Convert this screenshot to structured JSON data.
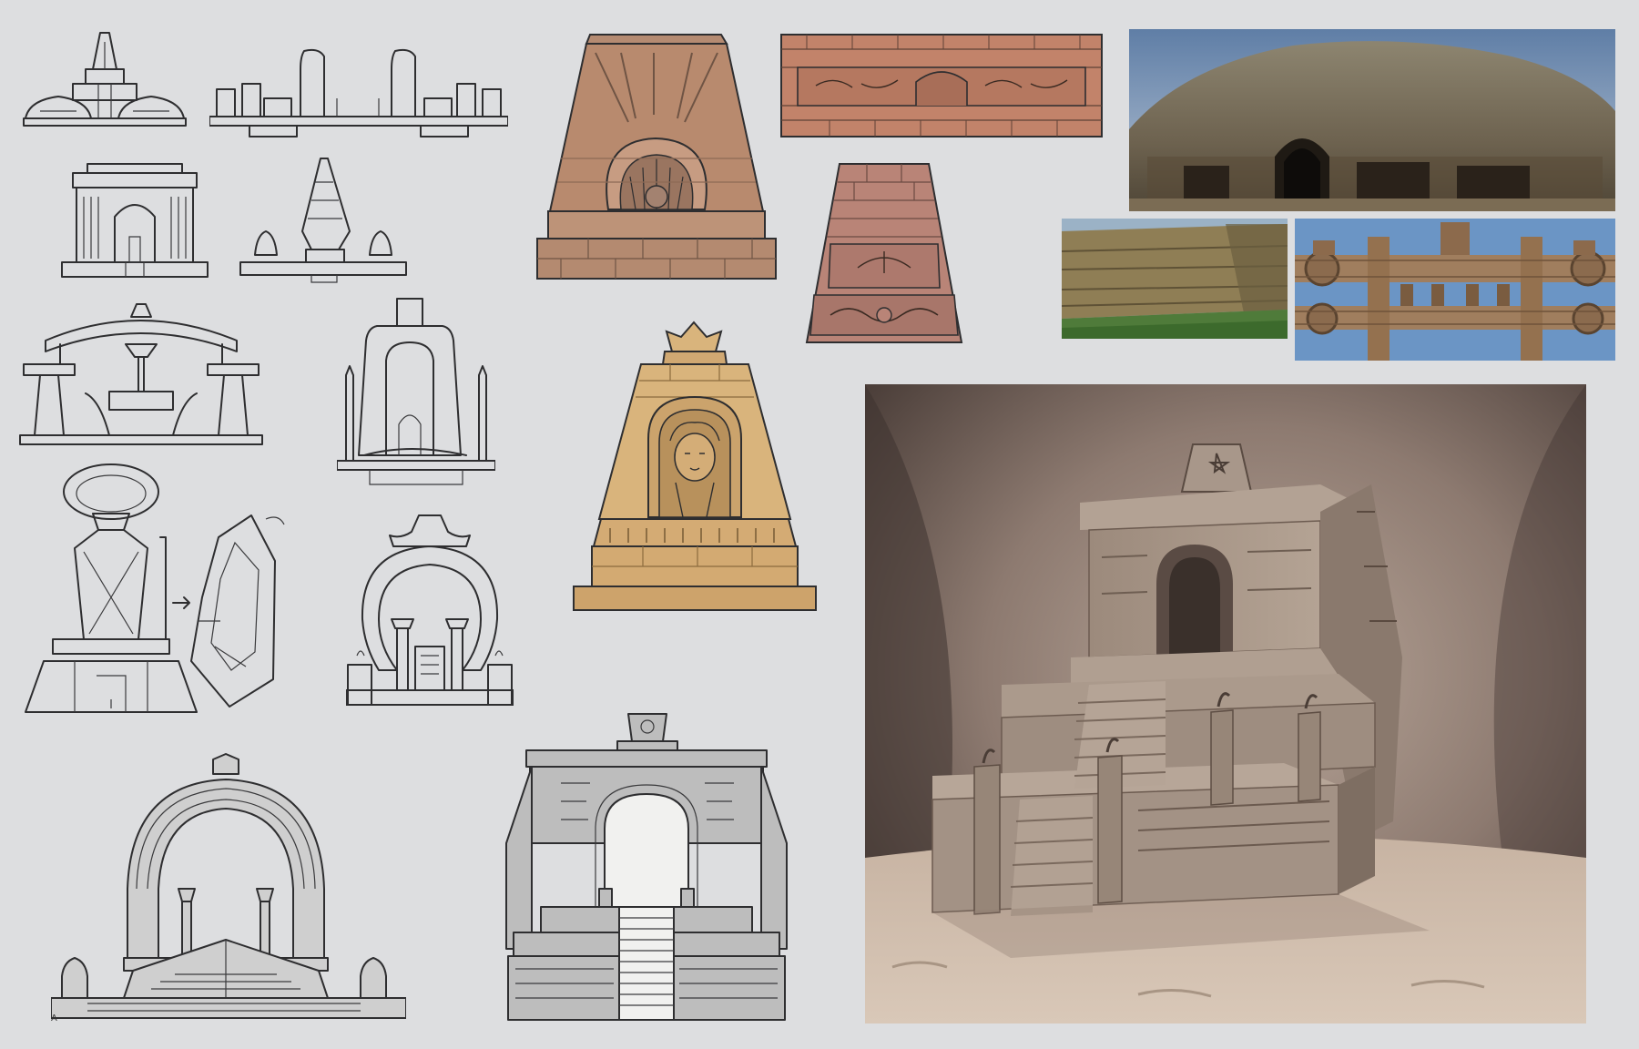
{
  "sheet": {
    "background": "#dddee0",
    "ink": "#2e2e30",
    "palette": {
      "terracotta": "#b88a6e",
      "terracotta_dark": "#8d6a55",
      "brick": "#c2836a",
      "rose": "#b98477",
      "ochre": "#d9b47c",
      "sand": "#a8978a",
      "gray_fill": "#bdbdbd"
    },
    "sketch_mark": "A"
  },
  "icons": [
    "domed-shrine-icon",
    "gate-pillars-icon",
    "arched-shrine-icon",
    "stepped-spire-icon",
    "bridge-arch-icon",
    "tall-portal-icon",
    "ring-throne-icon",
    "ring-gate-icon",
    "circular-arch-gate-icon",
    "shrine-elevation-icon"
  ]
}
